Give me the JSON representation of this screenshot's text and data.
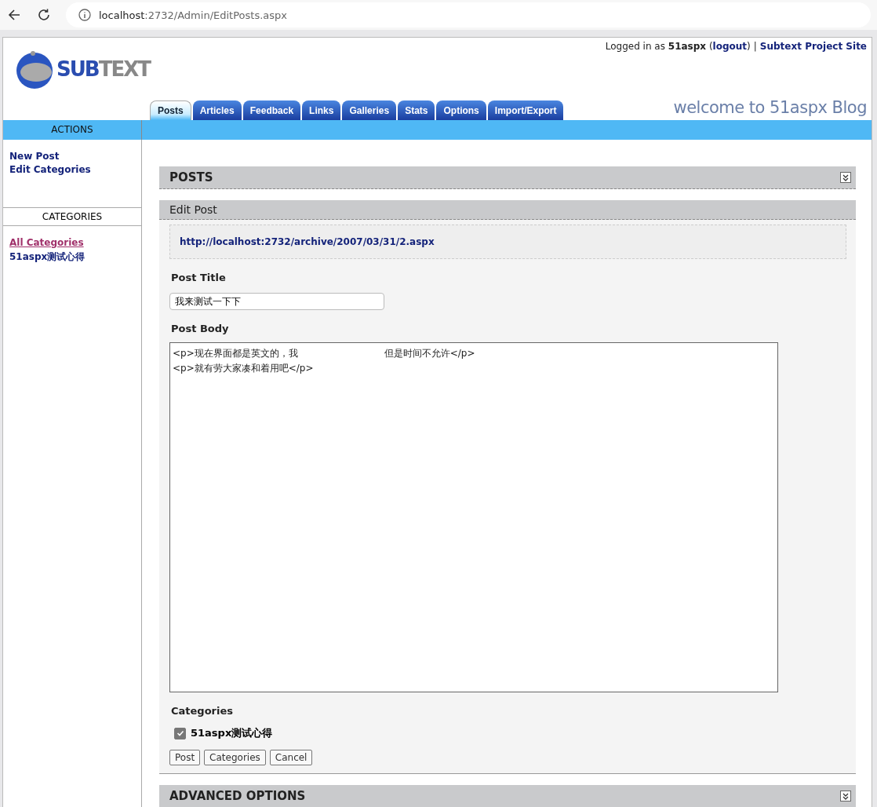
{
  "browser": {
    "url_host": "localhost",
    "url_path": ":2732/Admin/EditPosts.aspx"
  },
  "header": {
    "logo_text_a": "SUB",
    "logo_text_b": "TEXT",
    "logged_in_prefix": "Logged in as",
    "user": "51aspx",
    "paren_open": "(",
    "logout": "logout",
    "paren_close": ")",
    "separator": "|",
    "project_link": "Subtext Project Site",
    "blog_title": "welcome to 51aspx Blog"
  },
  "tabs": [
    {
      "label": "Posts",
      "selected": true
    },
    {
      "label": "Articles",
      "selected": false
    },
    {
      "label": "Feedback",
      "selected": false
    },
    {
      "label": "Links",
      "selected": false
    },
    {
      "label": "Galleries",
      "selected": false
    },
    {
      "label": "Stats",
      "selected": false
    },
    {
      "label": "Options",
      "selected": false
    },
    {
      "label": "Import/Export",
      "selected": false
    }
  ],
  "sidebar": {
    "actions_title": "ACTIONS",
    "actions": [
      {
        "label": "New Post"
      },
      {
        "label": "Edit Categories"
      }
    ],
    "categories_title": "CATEGORIES",
    "categories": [
      {
        "label": "All Categories",
        "selected": true
      },
      {
        "label": "51aspx测试心得",
        "selected": false
      }
    ]
  },
  "posts_section": {
    "title": "POSTS"
  },
  "edit_post": {
    "title": "Edit Post",
    "permalink": "http://localhost:2732/archive/2007/03/31/2.aspx",
    "title_label": "Post Title",
    "title_value": "我来测试一下下",
    "body_label": "Post Body",
    "body_lines": [
      {
        "parts": [
          "<p>现在界面都是英文的，我",
          "但是时间不允许</p>"
        ]
      },
      {
        "parts": [
          "<p>就有劳大家凑和着用吧</p>"
        ]
      }
    ],
    "categories_label": "Categories",
    "categories": [
      {
        "label": "51aspx测试心得",
        "checked": true
      }
    ],
    "buttons": [
      "Post",
      "Categories",
      "Cancel"
    ]
  },
  "advanced_section": {
    "title": "ADVANCED OPTIONS"
  }
}
